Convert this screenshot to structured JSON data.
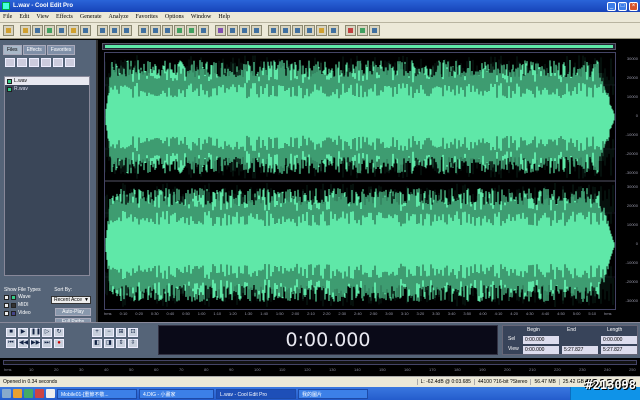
{
  "window": {
    "title": "L.wav - Cool Edit Pro"
  },
  "menu": [
    "File",
    "Edit",
    "View",
    "Effects",
    "Generate",
    "Analyze",
    "Favorites",
    "Options",
    "Window",
    "Help"
  ],
  "left_panel": {
    "tabs": [
      "Files",
      "Effects",
      "Favorites"
    ],
    "files": [
      "L.wav",
      "R.wav"
    ],
    "show_file_types_label": "Show File Types",
    "sort_by_label": "Sort By:",
    "file_types": [
      "Wave",
      "MIDI",
      "Video"
    ],
    "sort_value": "Recent Acce",
    "auto_play_label": "Auto-Play",
    "full_paths_label": "Full Paths"
  },
  "waveform": {
    "time_ruler": [
      "hms",
      "0:10",
      "0:20",
      "0:30",
      "0:40",
      "0:50",
      "1:00",
      "1:10",
      "1:20",
      "1:30",
      "1:40",
      "1:50",
      "2:00",
      "2:10",
      "2:20",
      "2:30",
      "2:40",
      "2:50",
      "3:00",
      "3:10",
      "3:20",
      "3:30",
      "3:40",
      "3:50",
      "4:00",
      "4:10",
      "4:20",
      "4:30",
      "4:40",
      "4:50",
      "5:00",
      "5:10",
      "hms"
    ],
    "amp_scale_top": [
      "30000",
      "20000",
      "10000",
      "0",
      "-10000",
      "-20000",
      "-30000"
    ],
    "amp_scale_bottom": [
      "30000",
      "20000",
      "10000",
      "0",
      "-10000",
      "-20000",
      "-30000"
    ],
    "wave_color": "#5fe8a8",
    "background_color": "#000000"
  },
  "transport": {
    "time": "0:00.000",
    "headers": [
      "Begin",
      "End",
      "Length"
    ],
    "rows": [
      {
        "label": "Sel",
        "begin": "0:00.000",
        "end": "",
        "length": "0:00.000"
      },
      {
        "label": "View",
        "begin": "0:00.000",
        "end": "5:27.827",
        "length": "5:27.827"
      }
    ]
  },
  "bottom_ruler": [
    "hms",
    "10",
    "20",
    "30",
    "40",
    "50",
    "60",
    "70",
    "80",
    "90",
    "100",
    "110",
    "120",
    "130",
    "140",
    "150",
    "160",
    "170",
    "180",
    "190",
    "200",
    "210",
    "220",
    "230",
    "240",
    "250"
  ],
  "status": {
    "main": "Opened in 0.34 seconds",
    "level": "L: -62.4dB @ 0:03.685",
    "format": "44100 ?16-bit ?Stereo",
    "size": "56.47 MB",
    "free": "25.42 GB free"
  },
  "taskbar": {
    "items": [
      "Mobile01-[重節不敬...",
      "4.DIG - 小畫家",
      "L.wav - Cool Edit Pro",
      "我的圖片"
    ],
    "watermark": "#213098"
  }
}
